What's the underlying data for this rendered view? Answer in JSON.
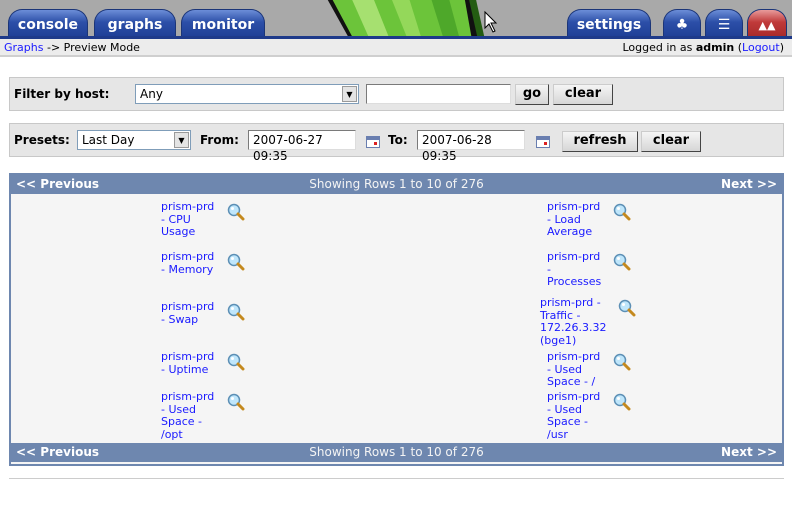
{
  "nav": {
    "tabs": [
      {
        "label": "console"
      },
      {
        "label": "graphs"
      },
      {
        "label": "monitor"
      }
    ],
    "settings": "settings",
    "icons": [
      "tree-view-icon",
      "list-view-icon",
      "preview-view-icon"
    ]
  },
  "breadcrumb": {
    "link": "Graphs",
    "rest": " -> Preview Mode"
  },
  "login": {
    "prefix": "Logged in as ",
    "user": "admin",
    "logout": "Logout"
  },
  "filter": {
    "label": "Filter by host:",
    "host": "Any",
    "search_value": "",
    "go": "go",
    "clear": "clear"
  },
  "timespan": {
    "presets_label": "Presets:",
    "preset": "Last Day",
    "from_label": "From:",
    "from": "2007-06-27 09:35",
    "to_label": "To:",
    "to": "2007-06-28 09:35",
    "refresh": "refresh",
    "clear": "clear"
  },
  "pager": {
    "previous": "<< Previous",
    "status": "Showing Rows 1 to 10 of 276",
    "next": "Next >>"
  },
  "graphs": [
    {
      "left": "prism-prd - CPU Usage",
      "right": "prism-prd - Load Average"
    },
    {
      "left": "prism-prd - Memory",
      "right": "prism-prd - Processes"
    },
    {
      "left": "prism-prd - Swap",
      "right": "prism-prd - Traffic - 172.26.3.32 (bge1)"
    },
    {
      "left": "prism-prd - Uptime",
      "right": "prism-prd - Used Space - /"
    },
    {
      "left": "prism-prd - Used Space - /opt",
      "right": "prism-prd - Used Space - /usr"
    }
  ],
  "colors": {
    "tab_blue": "#2c4fa8",
    "header_blue": "#6e87af",
    "link": "#1a1aff"
  }
}
